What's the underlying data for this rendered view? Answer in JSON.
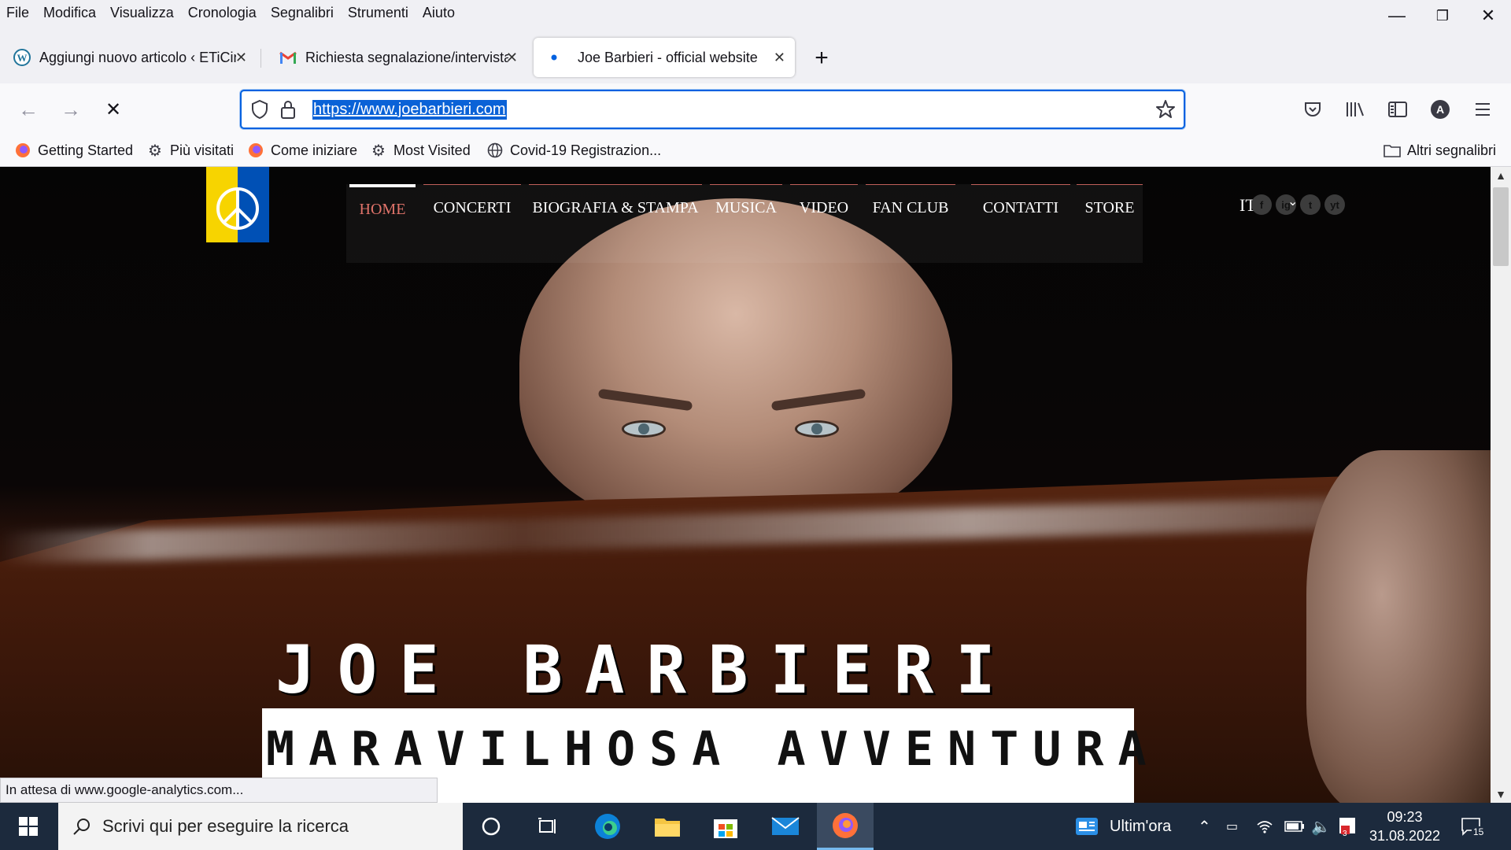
{
  "menu": [
    "File",
    "Modifica",
    "Visualizza",
    "Cronologia",
    "Segnalibri",
    "Strumenti",
    "Aiuto"
  ],
  "window_controls": {
    "minimize": "—",
    "restore": "❐",
    "close": "✕"
  },
  "tabs": [
    {
      "title": "Aggiungi nuovo articolo ‹ ETiCin",
      "favicon": "wordpress-icon",
      "close": "✕"
    },
    {
      "title": "Richiesta segnalazione/intervista",
      "favicon": "gmail-icon",
      "close": "✕"
    },
    {
      "title": "Joe Barbieri - official website",
      "favicon": "loading-dot-icon",
      "close": "✕",
      "active": true
    }
  ],
  "new_tab_label": "+",
  "nav": {
    "back": "←",
    "forward": "→",
    "stop": "✕"
  },
  "url": "https://www.joebarbieri.com",
  "bookmarks": [
    {
      "label": "Getting Started",
      "icon": "firefox-icon"
    },
    {
      "label": "Più visitati",
      "icon": "gear-icon"
    },
    {
      "label": "Come iniziare",
      "icon": "firefox-icon"
    },
    {
      "label": "Most Visited",
      "icon": "gear-icon"
    },
    {
      "label": "Covid-19 Registrazion...",
      "icon": "globe-icon"
    }
  ],
  "other_bookmarks": "Altri segnalibri",
  "site": {
    "nav": [
      "HOME",
      "CONCERTI",
      "BIOGRAFIA & STAMPA",
      "MUSICA",
      "VIDEO",
      "FAN CLUB",
      "CONTATTI",
      "STORE"
    ],
    "lang": "IT",
    "social": [
      "f",
      "ig",
      "t",
      "yt"
    ],
    "title": "JOE BARBIERI",
    "subtitle": "MARAVILHOSA AVVENTURA",
    "accent_color": "#e0736a"
  },
  "status_text": "In attesa di www.google-analytics.com...",
  "taskbar": {
    "search_placeholder": "Scrivi qui per eseguire la ricerca",
    "news": "Ultim'ora",
    "time": "09:23",
    "date": "31.08.2022",
    "notifications": "15",
    "antivirus_badge": "3"
  }
}
